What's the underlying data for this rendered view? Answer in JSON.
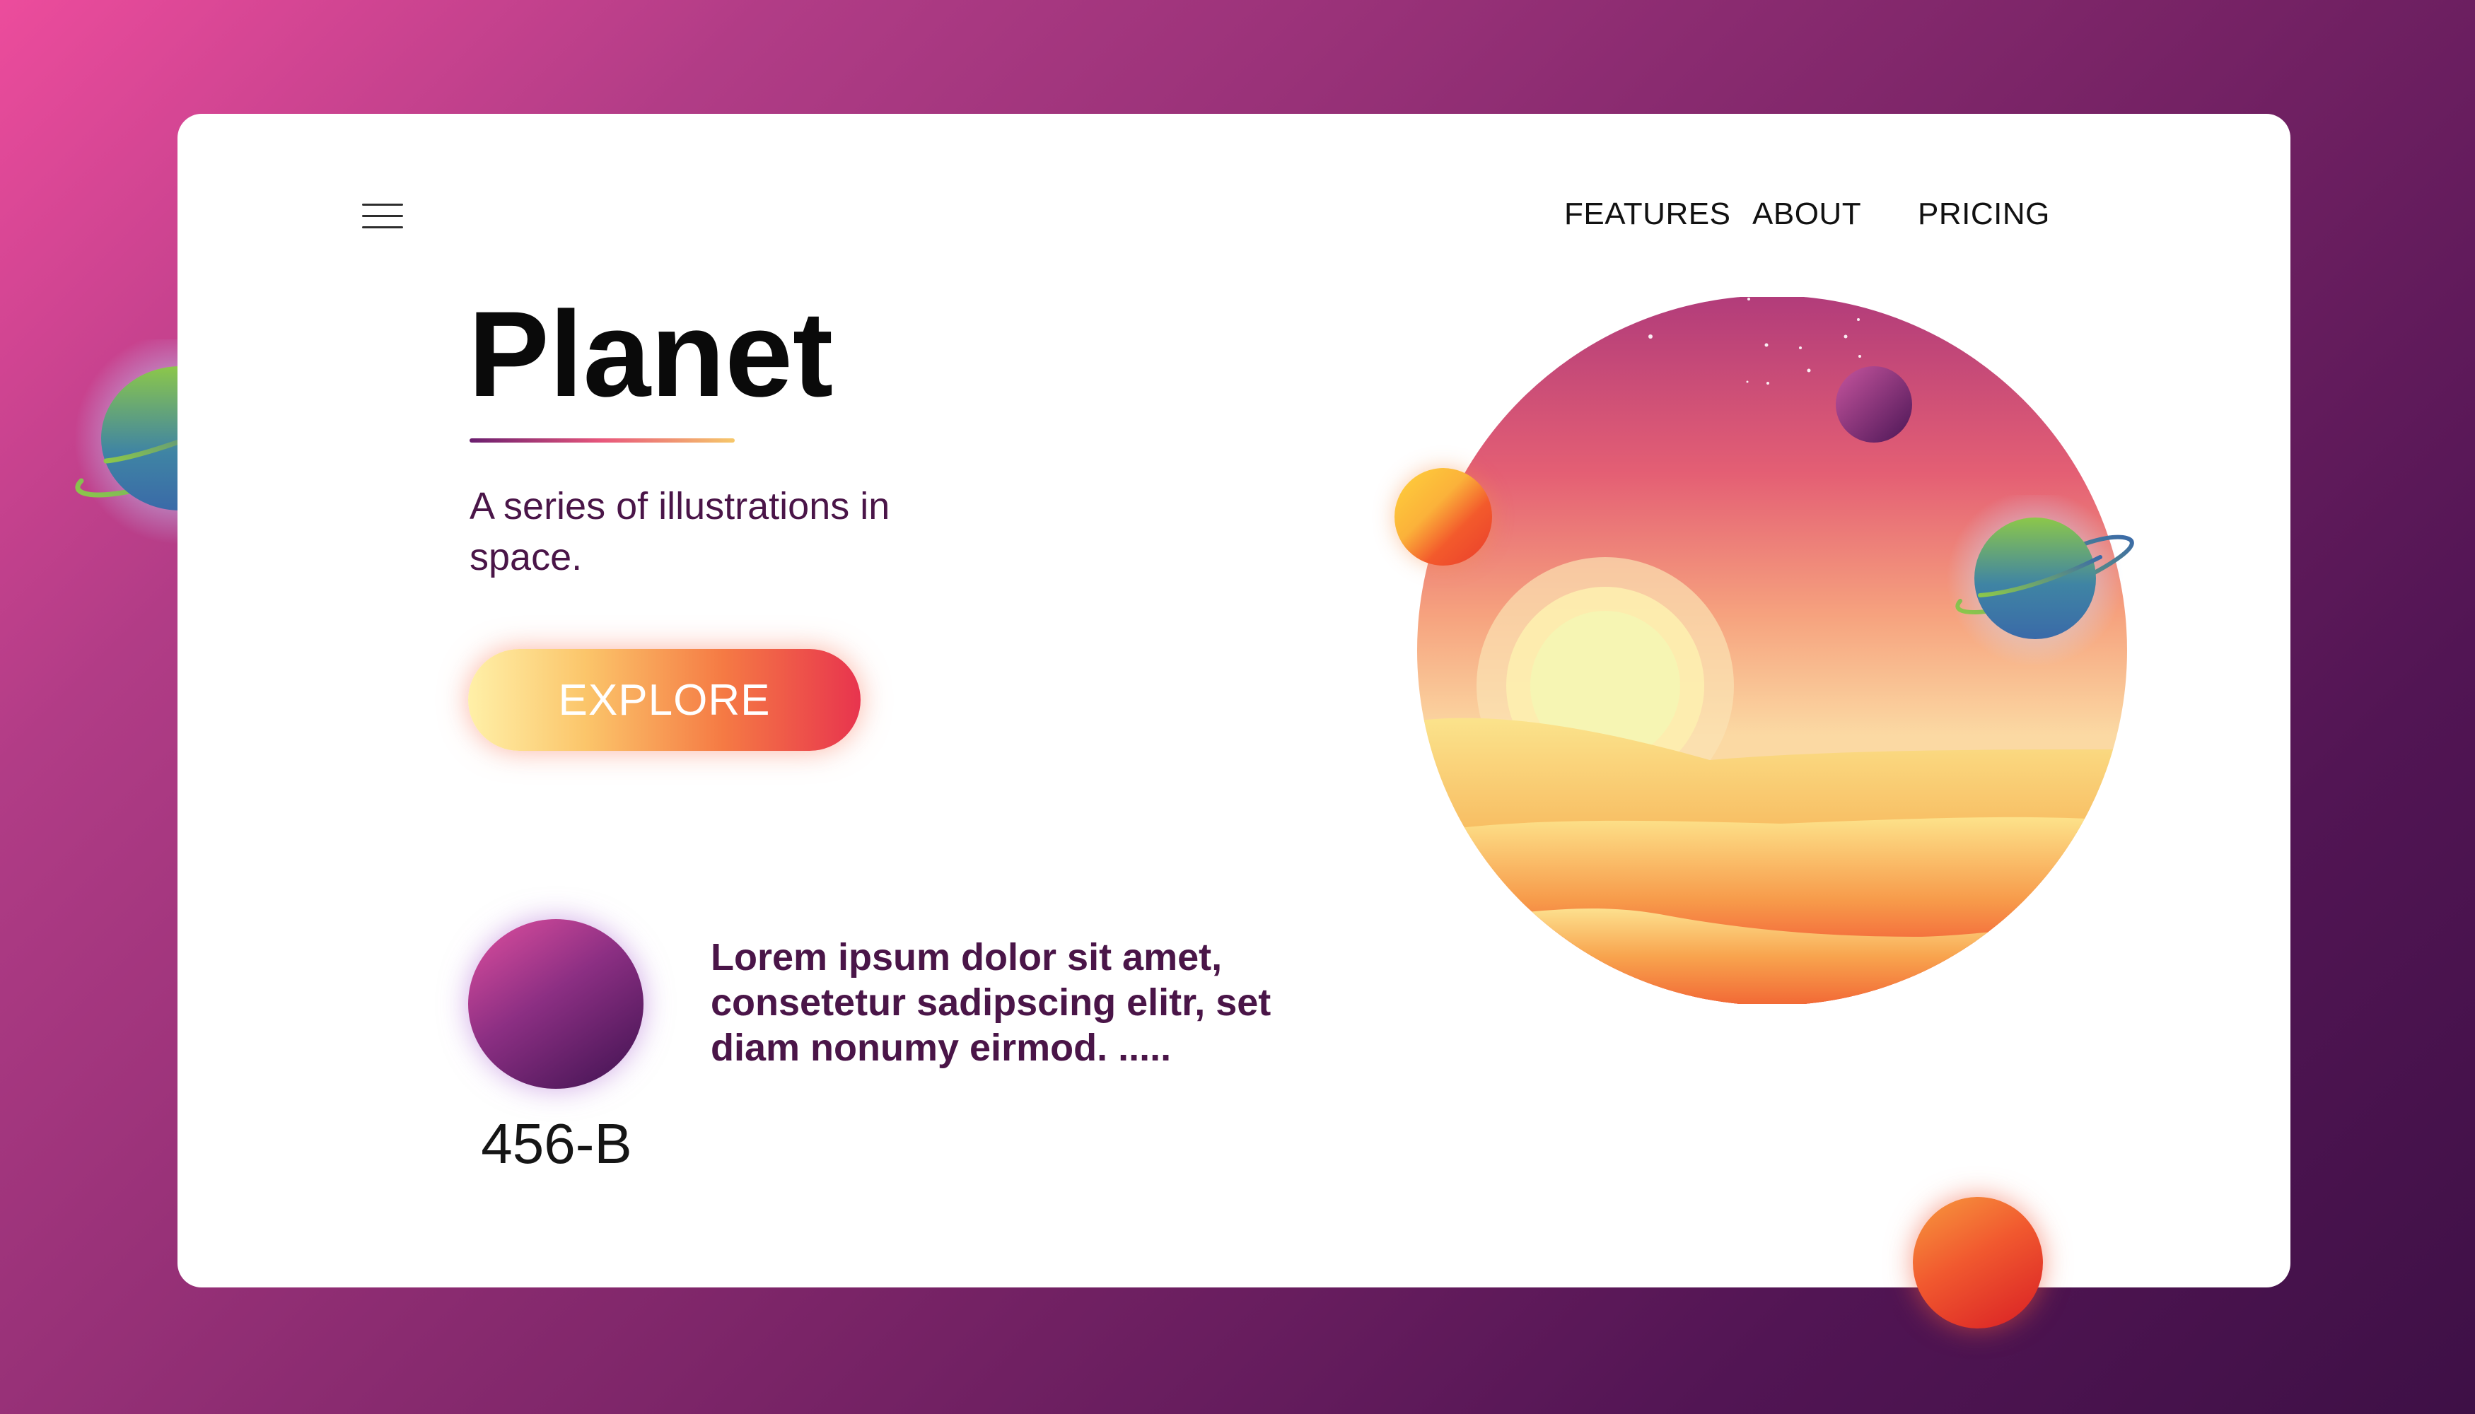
{
  "nav": {
    "menu_icon": "hamburger-menu-icon",
    "items": [
      {
        "label": "FEATURES"
      },
      {
        "label": "ABOUT"
      },
      {
        "label": "PRICING"
      }
    ]
  },
  "hero": {
    "title": "Planet",
    "subtitle": "A series of illustrations in space.",
    "cta_label": "EXPLORE"
  },
  "feature": {
    "planet_name": "456-B",
    "description": "Lorem ipsum dolor sit amet, consetetur sadipscing elitr, set diam nonumy eirmod. ....."
  },
  "colors": {
    "background_start": "#ec4c9c",
    "background_end": "#3e1046",
    "card": "#ffffff",
    "text_purple": "#4a1548",
    "cta_start": "#fff0a8",
    "cta_end": "#e8344e"
  }
}
